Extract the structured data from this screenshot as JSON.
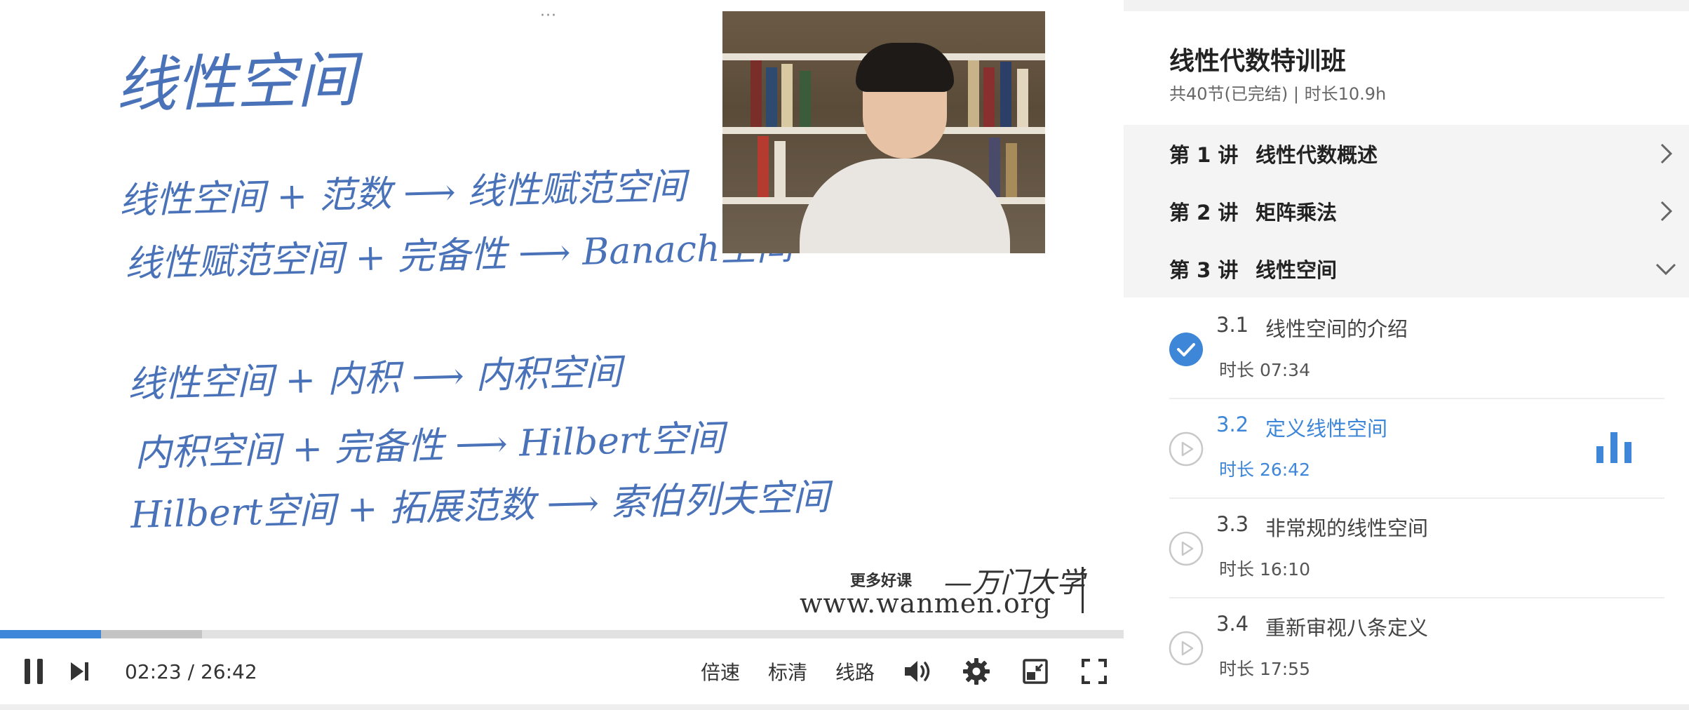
{
  "player": {
    "board_lines": [
      "线性空间",
      "线性空间 + 范数 ⟶ 线性赋范空间",
      "线性赋范空间 + 完备性 ⟶ Banach空间",
      "线性空间 + 内积 ⟶ 内积空间",
      "内积空间 + 完备性 ⟶ Hilbert空间",
      "Hilbert空间 + 拓展范数 ⟶ 索伯列夫空间"
    ],
    "watermark": {
      "promo": "更多好课",
      "brand": "—万门大学",
      "url": "www.wanmen.org"
    },
    "progress": {
      "played_fraction": 0.0898,
      "buffered_fraction": 0.18
    },
    "controls": {
      "current_time": "02:23",
      "separator": " / ",
      "total_time": "26:42",
      "speed_label": "倍速",
      "quality_label": "标清",
      "route_label": "线路"
    }
  },
  "panel": {
    "course_title": "线性代数特训班",
    "course_meta": "共40节(已完结) | 时长10.9h",
    "lectures": [
      {
        "number": "第 1 讲",
        "title": "线性代数概述",
        "expanded": false
      },
      {
        "number": "第 2 讲",
        "title": "矩阵乘法",
        "expanded": false
      },
      {
        "number": "第 3 讲",
        "title": "线性空间",
        "expanded": true
      }
    ],
    "lessons": [
      {
        "number": "3.1",
        "title": "线性空间的介绍",
        "duration": "时长 07:34",
        "status": "completed"
      },
      {
        "number": "3.2",
        "title": "定义线性空间",
        "duration": "时长 26:42",
        "status": "playing"
      },
      {
        "number": "3.3",
        "title": "非常规的线性空间",
        "duration": "时长 16:10",
        "status": "not-started"
      },
      {
        "number": "3.4",
        "title": "重新审视八条定义",
        "duration": "时长 17:55",
        "status": "not-started"
      }
    ]
  },
  "colors": {
    "accent": "#3d86d8",
    "ink": "#4a72b8"
  },
  "icons": {
    "pause": "pause-icon",
    "next": "next-icon",
    "volume": "volume-icon",
    "settings": "gear-icon",
    "pip": "picture-in-picture-icon",
    "fullscreen": "fullscreen-icon",
    "check": "check-circle-icon",
    "play": "play-circle-icon",
    "bars": "equalizer-icon",
    "chevron_right": "chevron-right-icon",
    "chevron_down": "chevron-down-icon"
  }
}
